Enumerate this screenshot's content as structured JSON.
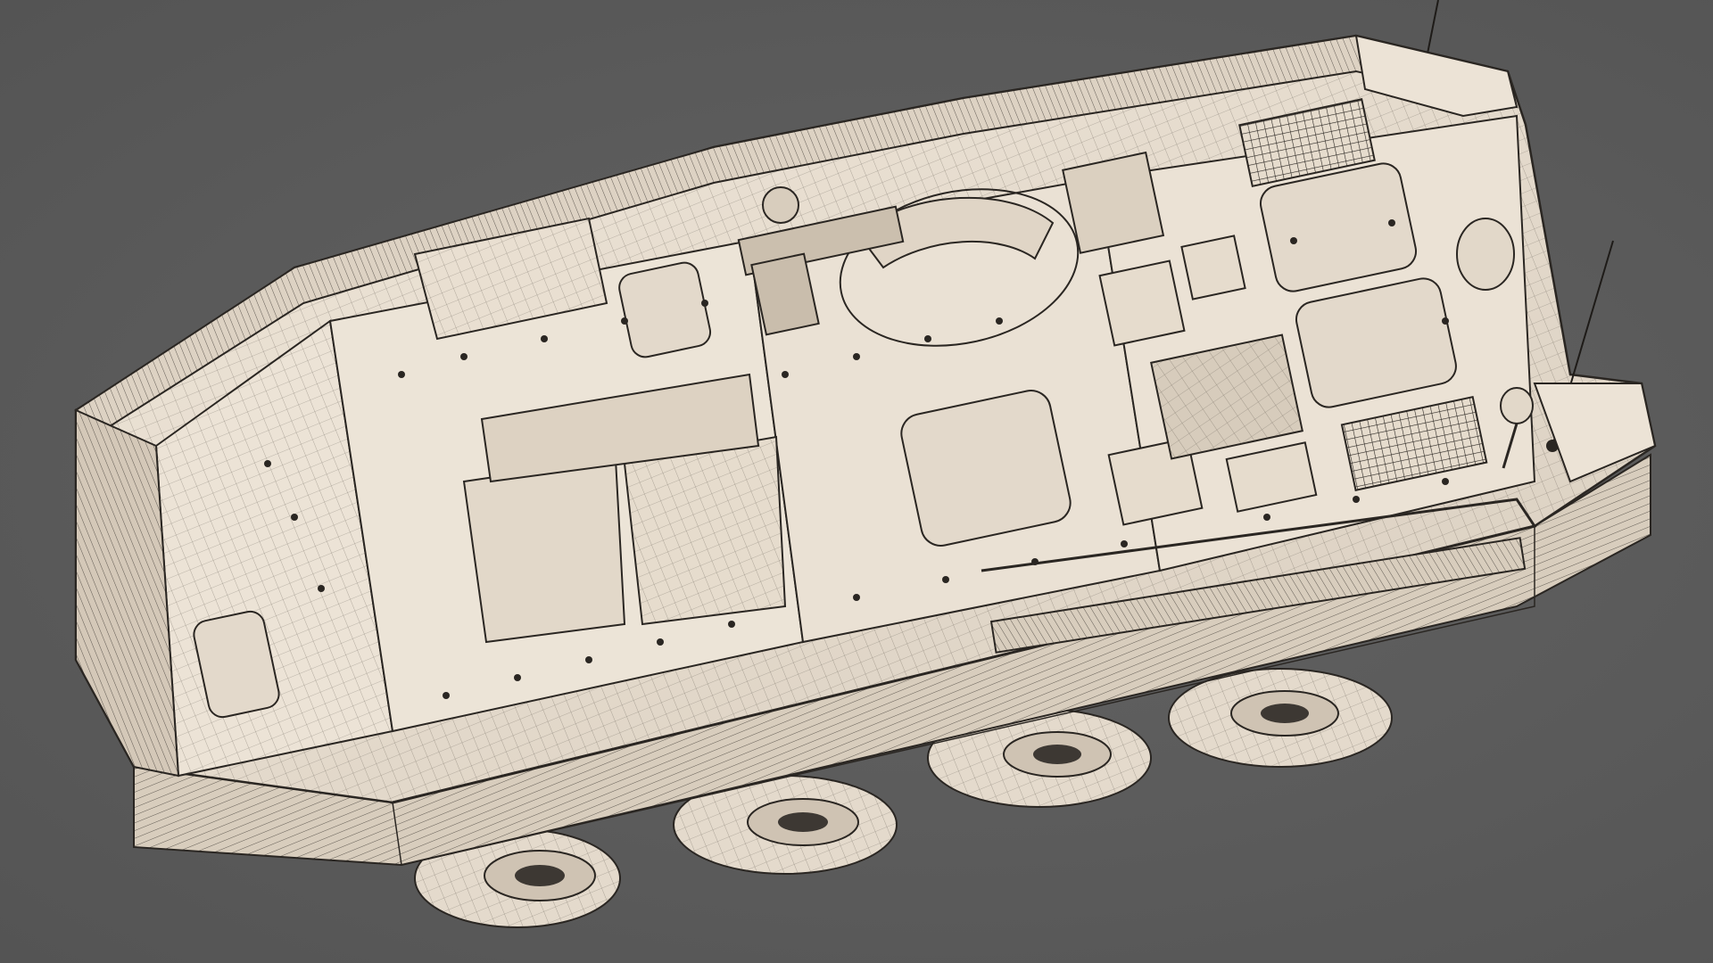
{
  "scene": {
    "subject": "armored-8x8-vehicle-wireframe-render",
    "background_color": "#5a5a5a",
    "hull_color": "#e6dccf",
    "wire_color": "#2a2622",
    "shadow_color": "#b9ad9d"
  }
}
